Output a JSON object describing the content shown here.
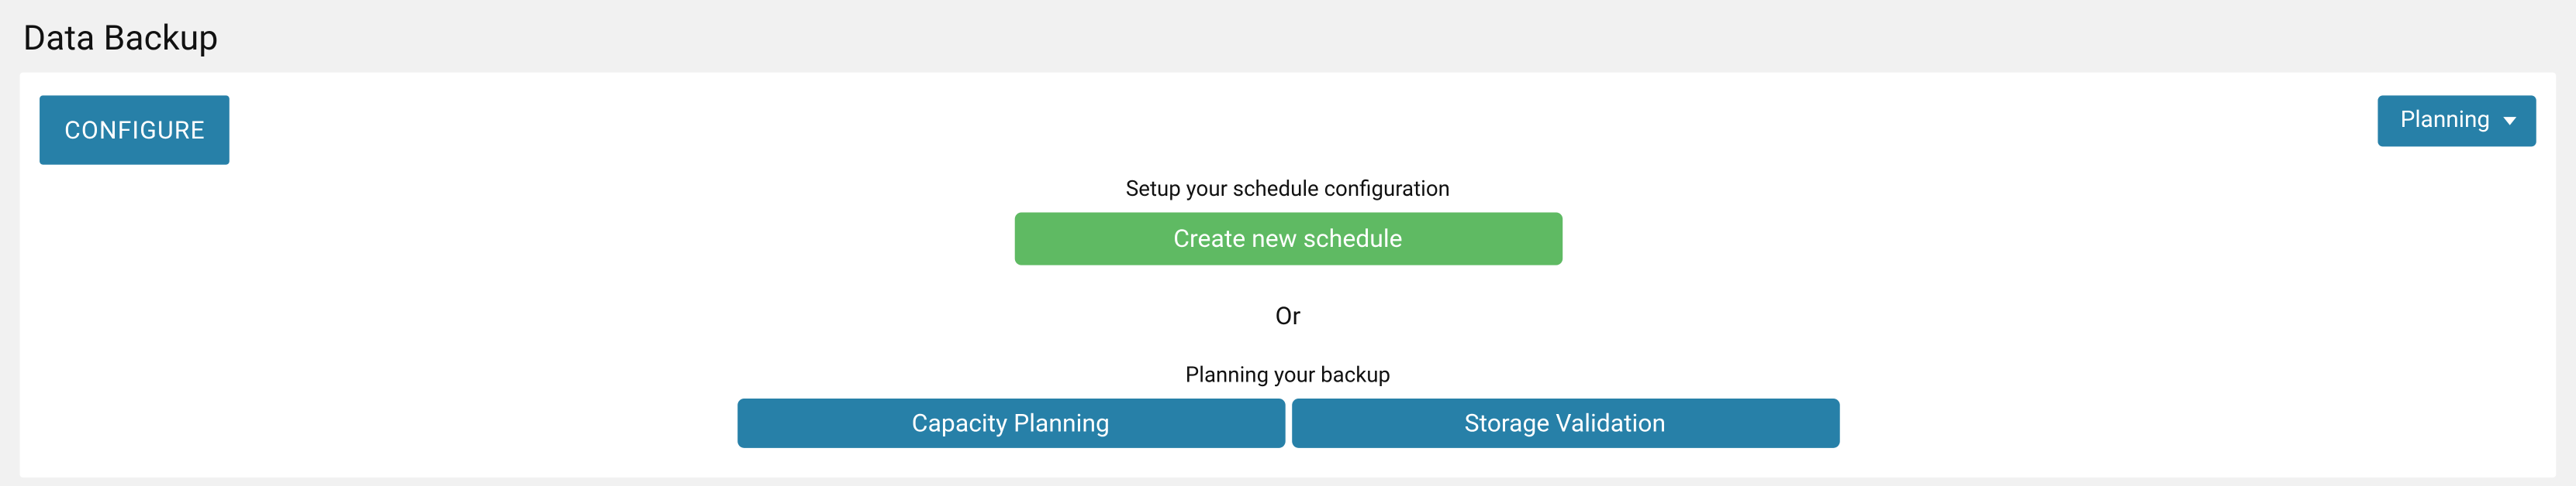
{
  "page": {
    "title": "Data Backup"
  },
  "panel": {
    "configure_label": "CONFIGURE",
    "planning_dropdown_label": "Planning",
    "setup_text": "Setup your schedule configuration",
    "create_schedule_label": "Create new schedule",
    "or_text": "Or",
    "planning_text": "Planning your backup",
    "capacity_planning_label": "Capacity Planning",
    "storage_validation_label": "Storage Validation"
  }
}
